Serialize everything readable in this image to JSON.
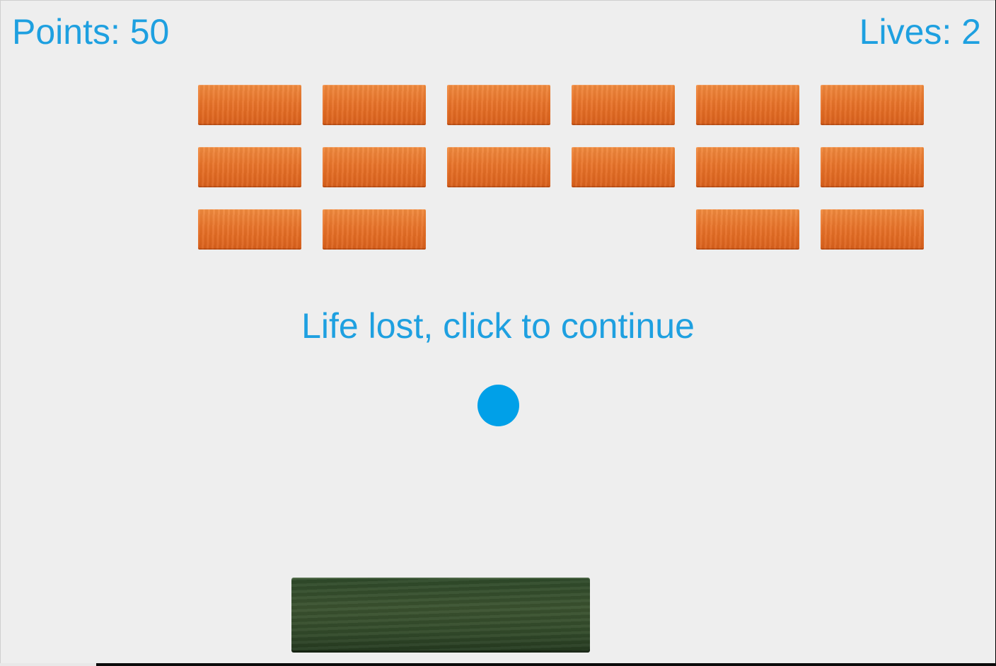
{
  "hud": {
    "score_text": "Points: 50",
    "lives_text": "Lives: 2"
  },
  "game": {
    "message": "Life lost, click to continue",
    "points": 50,
    "lives": 2,
    "brick_rows": [
      [
        true,
        true,
        true,
        true,
        true,
        true
      ],
      [
        true,
        true,
        true,
        true,
        true,
        true
      ],
      [
        true,
        true,
        false,
        false,
        true,
        true
      ]
    ]
  },
  "colors": {
    "background": "#eeeeee",
    "text": "#1ea0e0",
    "ball": "#00a0e8",
    "brick": "#e8732a",
    "paddle": "#3b5330"
  },
  "icons": {
    "ball": "ball-icon",
    "paddle": "paddle-icon",
    "brick": "brick-icon"
  }
}
